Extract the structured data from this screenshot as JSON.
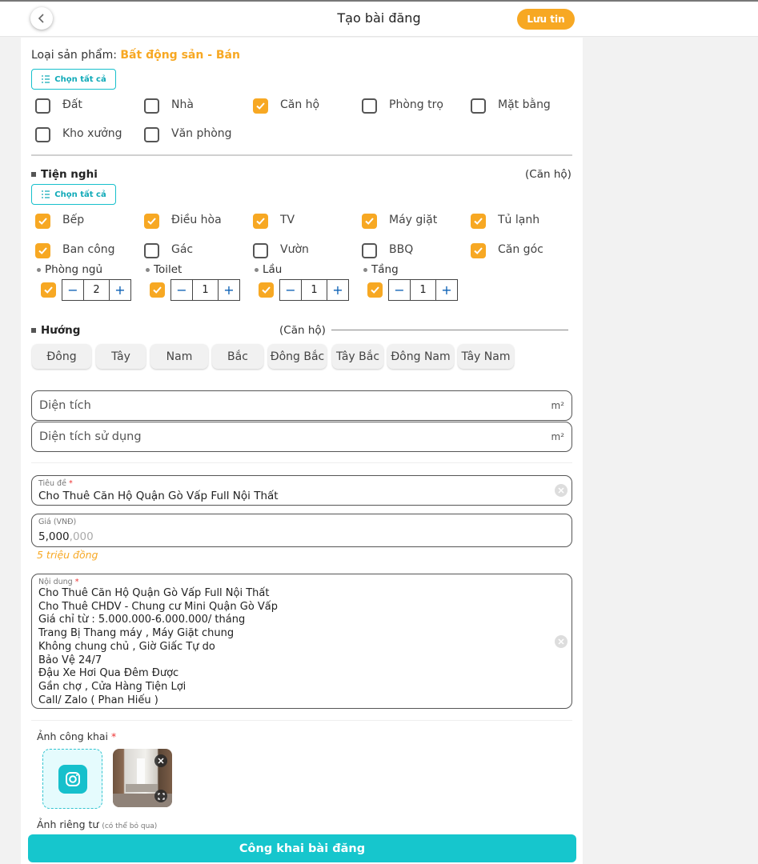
{
  "header": {
    "title": "Tạo bài đăng",
    "save_label": "Lưu tin"
  },
  "product_type": {
    "label": "Loại sản phẩm:",
    "value": "Bất động sản - Bán",
    "select_all": "Chọn tất cả",
    "options": [
      {
        "label": "Đất",
        "checked": false
      },
      {
        "label": "Nhà",
        "checked": false
      },
      {
        "label": "Căn hộ",
        "checked": true
      },
      {
        "label": "Phòng trọ",
        "checked": false
      },
      {
        "label": "Mặt bằng",
        "checked": false
      },
      {
        "label": "Kho xưởng",
        "checked": false
      },
      {
        "label": "Văn phòng",
        "checked": false
      }
    ]
  },
  "amenities": {
    "title": "Tiện nghi",
    "context": "(Căn hộ)",
    "select_all": "Chọn tất cả",
    "options": [
      {
        "label": "Bếp",
        "checked": true
      },
      {
        "label": "Điều hòa",
        "checked": true
      },
      {
        "label": "TV",
        "checked": true
      },
      {
        "label": "Máy giặt",
        "checked": true
      },
      {
        "label": "Tủ lạnh",
        "checked": true
      },
      {
        "label": "Ban công",
        "checked": true
      },
      {
        "label": "Gác",
        "checked": false
      },
      {
        "label": "Vườn",
        "checked": false
      },
      {
        "label": "BBQ",
        "checked": false
      },
      {
        "label": "Căn góc",
        "checked": true
      }
    ],
    "counters": [
      {
        "label": "Phòng ngủ",
        "value": "2",
        "checked": true
      },
      {
        "label": "Toilet",
        "value": "1",
        "checked": true
      },
      {
        "label": "Lầu",
        "value": "1",
        "checked": true
      },
      {
        "label": "Tầng",
        "value": "1",
        "checked": true
      }
    ]
  },
  "direction": {
    "title": "Hướng",
    "context": "(Căn hộ)",
    "options": [
      "Đông",
      "Tây",
      "Nam",
      "Bắc",
      "Đông Bắc",
      "Tây Bắc",
      "Đông Nam",
      "Tây Nam"
    ]
  },
  "area": {
    "placeholder": "Diện tích",
    "unit": "m²"
  },
  "usable_area": {
    "placeholder": "Diện tích sử dụng",
    "unit": "m²"
  },
  "title_field": {
    "label": "Tiêu đề",
    "required": "*",
    "value": "Cho Thuê Căn Hộ Quận Gò Vấp Full Nội Thất"
  },
  "price": {
    "label": "Giá (VNĐ)",
    "value": "5,000",
    "suffix": ",000",
    "hint": "5 triệu đồng"
  },
  "content": {
    "label": "Nội dung",
    "required": "*",
    "lines": [
      "Cho Thuê Căn Hộ Quận Gò Vấp Full Nội Thất",
      "Cho Thuê CHDV - Chung cư Mini Quận Gò Vấp",
      "Giá chỉ từ : 5.000.000-6.000.000/ tháng",
      "Trang Bị Thang máy , Máy Giặt chung",
      "Không chung chủ , Giờ Giấc Tự do",
      "Bảo Vệ 24/7",
      "Đậu Xe Hơi Qua Đêm Được",
      "Gần chợ , Cửa Hàng Tiện Lợi",
      "Call/ Zalo ( Phan Hiếu )"
    ]
  },
  "public_photos": {
    "label": "Ảnh công khai",
    "required": "*"
  },
  "private_photos": {
    "label": "Ảnh riêng tư",
    "note": "(có thể bỏ qua)"
  },
  "publish_button": "Công khai bài đăng",
  "colors": {
    "accent": "#f7a823",
    "teal": "#16c6cd"
  }
}
